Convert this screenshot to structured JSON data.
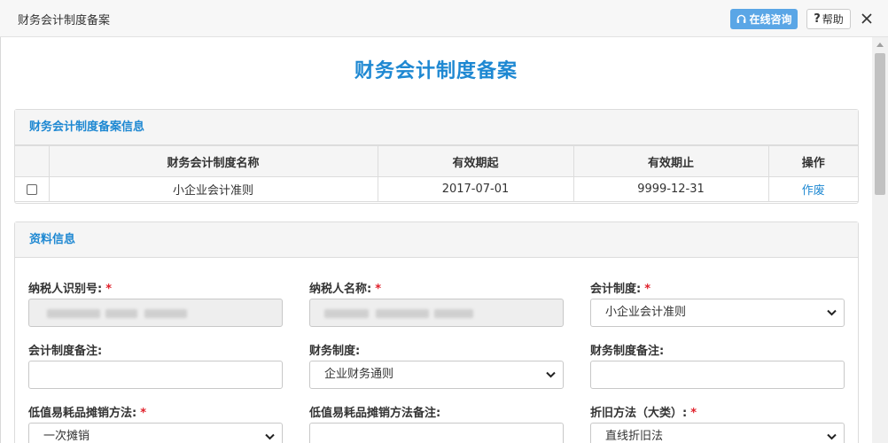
{
  "window": {
    "title": "财务会计制度备案",
    "online_label": "在线咨询",
    "help_label": "帮助"
  },
  "page": {
    "title": "财务会计制度备案"
  },
  "records_panel": {
    "title": "财务会计制度备案信息",
    "columns": [
      "",
      "财务会计制度名称",
      "有效期起",
      "有效期止",
      "操作"
    ],
    "rows": [
      {
        "name": "小企业会计准则",
        "start": "2017-07-01",
        "end": "9999-12-31",
        "action": "作废"
      }
    ]
  },
  "info_panel": {
    "title": "资料信息",
    "fields": {
      "taxpayer_id": {
        "label": "纳税人识别号:",
        "required": "*",
        "value": ""
      },
      "taxpayer_name": {
        "label": "纳税人名称:",
        "required": "*",
        "value": ""
      },
      "accounting_system": {
        "label": "会计制度:",
        "required": "*",
        "value": "小企业会计准则"
      },
      "accounting_note": {
        "label": "会计制度备注:",
        "value": ""
      },
      "finance_system": {
        "label": "财务制度:",
        "value": "企业财务通则"
      },
      "finance_note": {
        "label": "财务制度备注:",
        "value": ""
      },
      "low_value_method": {
        "label": "低值易耗品摊销方法:",
        "required": "*",
        "value": "一次摊销"
      },
      "low_value_note": {
        "label": "低值易耗品摊销方法备注:",
        "value": ""
      },
      "depreciation_method": {
        "label": "折旧方法（大类）:",
        "required": "*",
        "value": "直线折旧法"
      }
    }
  },
  "colors": {
    "accent": "#1e88d2",
    "online_button": "#5aa6e6",
    "required": "#e0202a"
  }
}
